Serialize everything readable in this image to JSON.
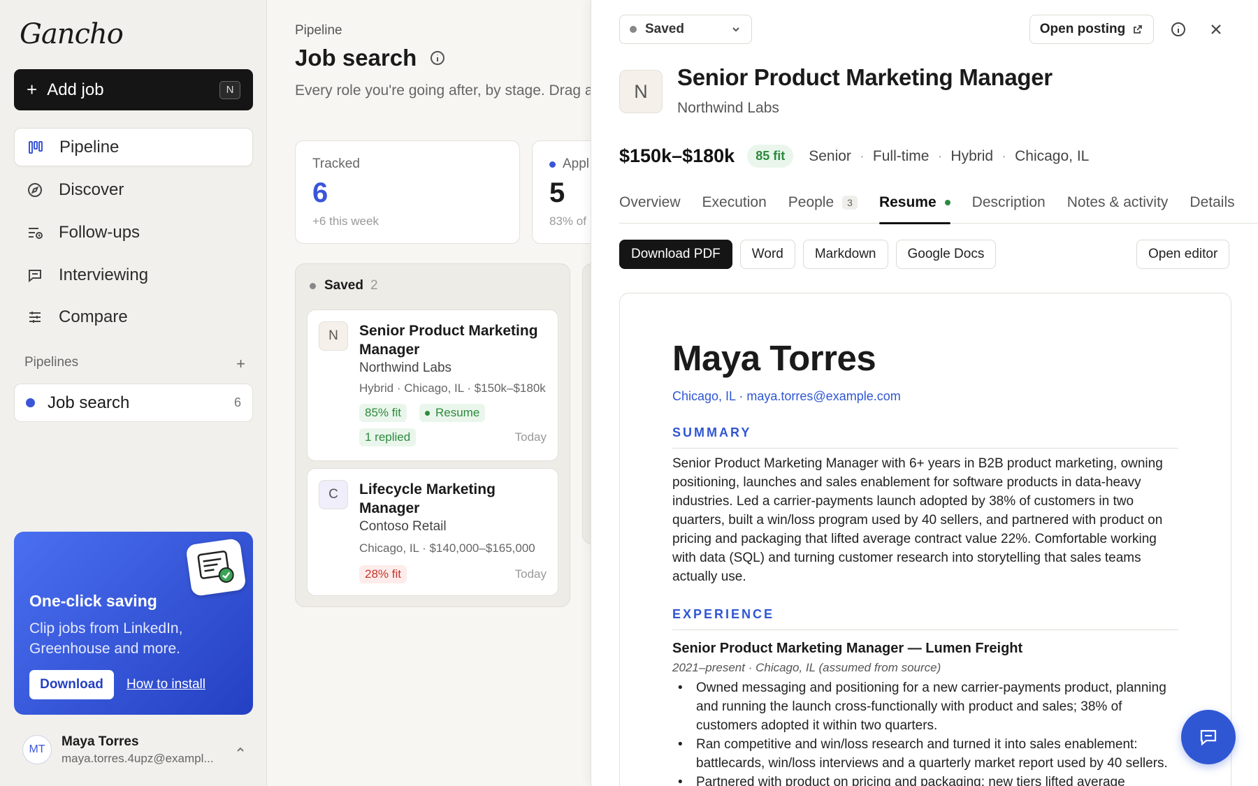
{
  "app": {
    "logo_text": "Gancho"
  },
  "sidebar": {
    "add_job_label": "Add job",
    "add_job_shortcut": "N",
    "nav": [
      {
        "label": "Pipeline",
        "icon": "kanban-icon",
        "active": true
      },
      {
        "label": "Discover",
        "icon": "compass-icon"
      },
      {
        "label": "Follow-ups",
        "icon": "list-clock-icon"
      },
      {
        "label": "Interviewing",
        "icon": "chat-icon"
      },
      {
        "label": "Compare",
        "icon": "sliders-icon"
      }
    ],
    "pipelines_label": "Pipelines",
    "pipeline_item": {
      "label": "Job search",
      "count": "6"
    },
    "promo": {
      "title": "One-click saving",
      "body": "Clip jobs from LinkedIn, Greenhouse and more.",
      "download_label": "Download",
      "howto_label": "How to install"
    },
    "user": {
      "initials": "MT",
      "name": "Maya Torres",
      "email": "maya.torres.4upz@exampl..."
    }
  },
  "main": {
    "breadcrumb": "Pipeline",
    "title": "Job search",
    "subtitle": "Every role you're going after, by stage. Drag a",
    "stats": [
      {
        "label": "Tracked",
        "value": "6",
        "foot": "+6 this week"
      },
      {
        "label": "Appl",
        "value": "5",
        "foot": "83% of"
      }
    ],
    "column": {
      "label": "Saved",
      "count": "2",
      "cards": [
        {
          "initial": "N",
          "title": "Senior Product Marketing Manager",
          "company": "Northwind Labs",
          "meta": "Hybrid · Chicago, IL · $150k–$180k",
          "fit": "85% fit",
          "resume_tag": "Resume",
          "replied": "1 replied",
          "date": "Today"
        },
        {
          "initial": "C",
          "title": "Lifecycle Marketing Manager",
          "company": "Contoso Retail",
          "meta": "Chicago, IL · $140,000–$165,000",
          "fit": "28% fit",
          "date": "Today"
        }
      ]
    }
  },
  "drawer": {
    "status": "Saved",
    "open_posting": "Open posting",
    "company_initial": "N",
    "job_title": "Senior Product Marketing Manager",
    "company": "Northwind Labs",
    "salary": "$150k–$180k",
    "fit": "85 fit",
    "meta": [
      "Senior",
      "Full-time",
      "Hybrid",
      "Chicago, IL"
    ],
    "tabs": [
      {
        "label": "Overview"
      },
      {
        "label": "Execution"
      },
      {
        "label": "People",
        "badge": "3"
      },
      {
        "label": "Resume",
        "active": true
      },
      {
        "label": "Description"
      },
      {
        "label": "Notes & activity"
      },
      {
        "label": "Details"
      }
    ],
    "actions": {
      "pdf": "Download PDF",
      "word": "Word",
      "markdown": "Markdown",
      "gdocs": "Google Docs",
      "editor": "Open editor"
    },
    "resume": {
      "name": "Maya Torres",
      "contact": "Chicago, IL · maya.torres@example.com",
      "summary_heading": "SUMMARY",
      "summary": "Senior Product Marketing Manager with 6+ years in B2B product marketing, owning positioning, launches and sales enablement for software products in data-heavy industries. Led a carrier-payments launch adopted by 38% of customers in two quarters, built a win/loss program used by 40 sellers, and partnered with product on pricing and packaging that lifted average contract value 22%. Comfortable working with data (SQL) and turning customer research into storytelling that sales teams actually use.",
      "experience_heading": "EXPERIENCE",
      "role": "Senior Product Marketing Manager — Lumen Freight",
      "dates": "2021–present · Chicago, IL (assumed from source)",
      "bullets": [
        "Owned messaging and positioning for a new carrier-payments product, planning and running the launch cross-functionally with product and sales; 38% of customers adopted it within two quarters.",
        "Ran competitive and win/loss research and turned it into sales enablement: battlecards, win/loss interviews and a quarterly market report used by 40 sellers.",
        "Partnered with product on pricing and packaging; new tiers lifted average"
      ]
    }
  }
}
